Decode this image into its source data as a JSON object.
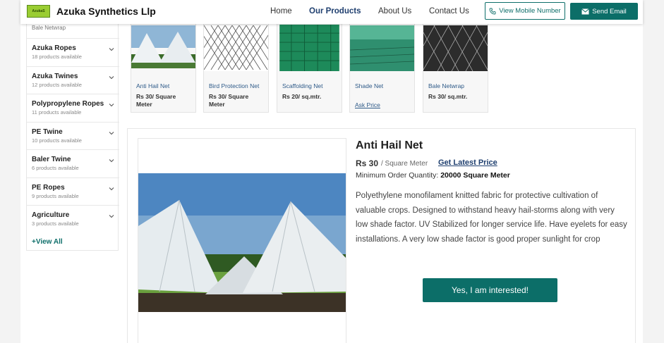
{
  "header": {
    "logo_text": "AzukaS",
    "company": "Azuka Synthetics Llp",
    "nav": [
      {
        "label": "Home"
      },
      {
        "label": "Our Products"
      },
      {
        "label": "About Us"
      },
      {
        "label": "Contact Us"
      }
    ],
    "mobile_button": "View Mobile Number",
    "email_button": "Send Email"
  },
  "sidebar": {
    "previous_item": "Bale Netwrap",
    "categories": [
      {
        "name": "Azuka Ropes",
        "count": "18 products available"
      },
      {
        "name": "Azuka Twines",
        "count": "12 products available"
      },
      {
        "name": "Polypropylene Ropes",
        "count": "11 products available"
      },
      {
        "name": "PE Twine",
        "count": "10 products available"
      },
      {
        "name": "Baler Twine",
        "count": "6 products available"
      },
      {
        "name": "PE Ropes",
        "count": "9 products available"
      },
      {
        "name": "Agriculture",
        "count": "3 products available"
      }
    ],
    "view_all": "+View All"
  },
  "products": [
    {
      "name": "Anti Hail Net",
      "price": "Rs 30/ Square Meter"
    },
    {
      "name": "Bird Protection Net",
      "price": "Rs 30/ Square Meter"
    },
    {
      "name": "Scaffolding Net",
      "price": "Rs 20/ sq.mtr."
    },
    {
      "name": "Shade Net",
      "price": "Ask Price"
    },
    {
      "name": "Bale Netwrap",
      "price": "Rs 30/ sq.mtr."
    }
  ],
  "detail": {
    "title": "Anti Hail Net",
    "price": "Rs 30",
    "unit": "/ Square Meter",
    "latest_price": "Get Latest Price",
    "moq_label": "Minimum Order Quantity:",
    "moq_value": "20000 Square Meter",
    "description": "Polyethylene monofilament knitted fabric for protective cultivation of valuable crops. Designed to withstand heavy hail-storms along with very low shade factor. UV Stabilized for longer service life. Have eyelets for easy installations. A very low shade factor is good proper sunlight for crop",
    "cta": "Yes, I am interested!"
  },
  "colors": {
    "brand_teal": "#0c6e68",
    "nav_active": "#1f3f6f",
    "link_blue": "#2e5a88"
  }
}
